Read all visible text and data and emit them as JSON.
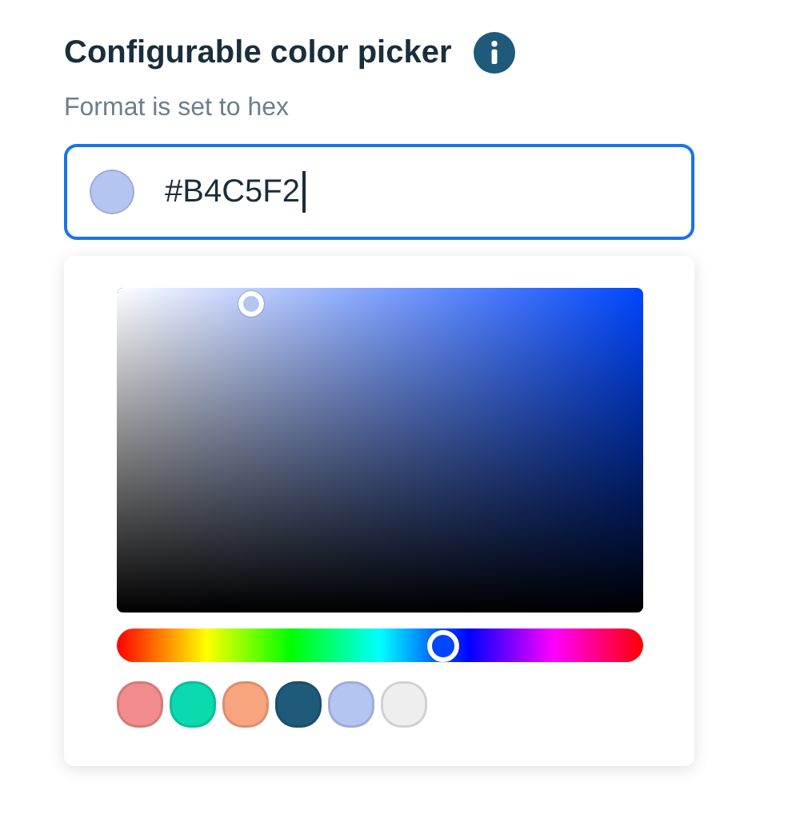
{
  "title": "Configurable color picker",
  "helper_text": "Format is set to hex",
  "color_field": {
    "value": "#B4C5F2",
    "focused": true
  },
  "swatches": [
    {
      "color": "#f28b8b"
    },
    {
      "color": "#0bd9ae"
    },
    {
      "color": "#f8a47e"
    },
    {
      "color": "#1f5a7a"
    },
    {
      "color": "#b4c5f2"
    },
    {
      "color": "#eeeeee"
    }
  ]
}
